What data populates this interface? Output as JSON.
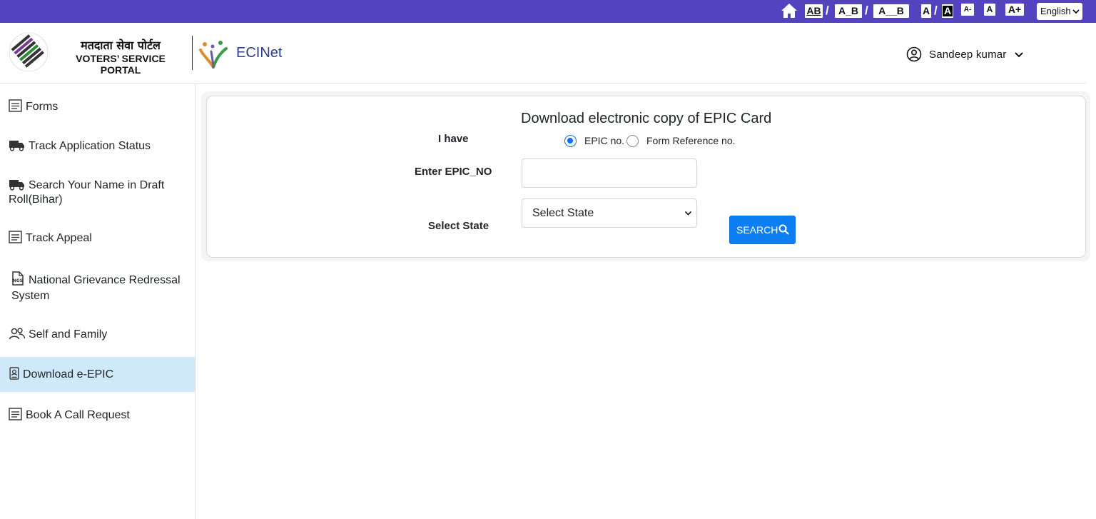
{
  "topbar": {
    "contrast_options": [
      "AB",
      "A_B",
      "A__B"
    ],
    "theme_options": [
      "A",
      "A"
    ],
    "size_options": [
      "A-",
      "A",
      "A+"
    ],
    "language": "English"
  },
  "header": {
    "brand_hindi": "मतदाता सेवा पोर्टल",
    "brand_english": "VOTERS’ SERVICE PORTAL",
    "app_name": "ECINet",
    "user_name": "Sandeep kumar"
  },
  "sidebar": {
    "items": [
      {
        "label": "Forms",
        "icon": "form-icon"
      },
      {
        "label": "Track Application Status",
        "icon": "truck-icon"
      },
      {
        "label": "Search Your Name in Draft Roll(Bihar)",
        "icon": "truck-icon"
      },
      {
        "label": "Track Appeal",
        "icon": "form-icon"
      },
      {
        "label": "National Grievance Redressal System",
        "icon": "document-icon"
      },
      {
        "label": "Self and Family",
        "icon": "users-icon"
      },
      {
        "label": "Download e-EPIC",
        "icon": "id-card-icon",
        "active": true
      },
      {
        "label": "Book A Call Request",
        "icon": "form-icon"
      }
    ]
  },
  "main": {
    "title": "Download electronic copy of EPIC Card",
    "i_have_label": "I have",
    "radio_epic": "EPIC no.",
    "radio_form_ref": "Form Reference no.",
    "epic_label": "Enter EPIC_NO",
    "epic_value": "",
    "state_label": "Select State",
    "state_selected": "Select State",
    "search_button": "SEARCH"
  },
  "colors": {
    "topbar": "#5343bf",
    "active_sidebar": "#cfe9fb",
    "primary": "#0d7ff5"
  }
}
